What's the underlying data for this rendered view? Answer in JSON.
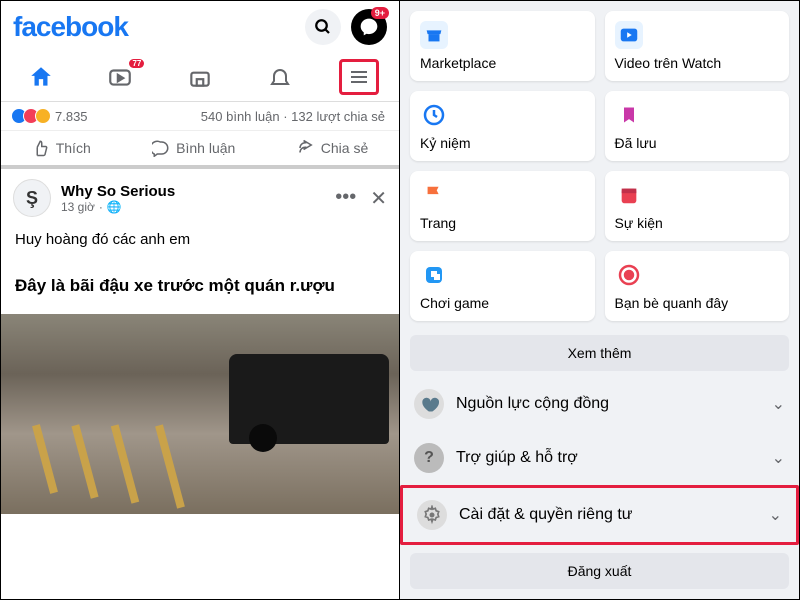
{
  "colors": {
    "brand": "#1877f2",
    "highlight": "#e41e3f"
  },
  "left": {
    "logo": "facebook",
    "messenger_badge": "9+",
    "tabs": {
      "watch_badge": "77"
    },
    "stats": {
      "reaction_count": "7.835",
      "comments": "540 bình luận",
      "shares": "132 lượt chia sẻ"
    },
    "actions": {
      "like": "Thích",
      "comment": "Bình luận",
      "share": "Chia sẻ"
    },
    "post": {
      "avatar_letter": "Ş",
      "author": "Why So Serious",
      "time": "13 giờ",
      "privacy": "🌐",
      "text": "Huy hoàng đó các anh em",
      "caption": "Đây là bãi đậu xe trước một quán r.ượu"
    }
  },
  "right": {
    "tiles": [
      {
        "label": "Marketplace"
      },
      {
        "label": "Video trên Watch"
      },
      {
        "label": "Kỷ niệm"
      },
      {
        "label": "Đã lưu"
      },
      {
        "label": "Trang"
      },
      {
        "label": "Sự kiện"
      },
      {
        "label": "Chơi game"
      },
      {
        "label": "Bạn bè quanh đây"
      }
    ],
    "see_more": "Xem thêm",
    "list": [
      {
        "label": "Nguồn lực cộng đồng"
      },
      {
        "label": "Trợ giúp & hỗ trợ"
      },
      {
        "label": "Cài đặt & quyền riêng tư"
      }
    ],
    "logout": "Đăng xuất"
  }
}
